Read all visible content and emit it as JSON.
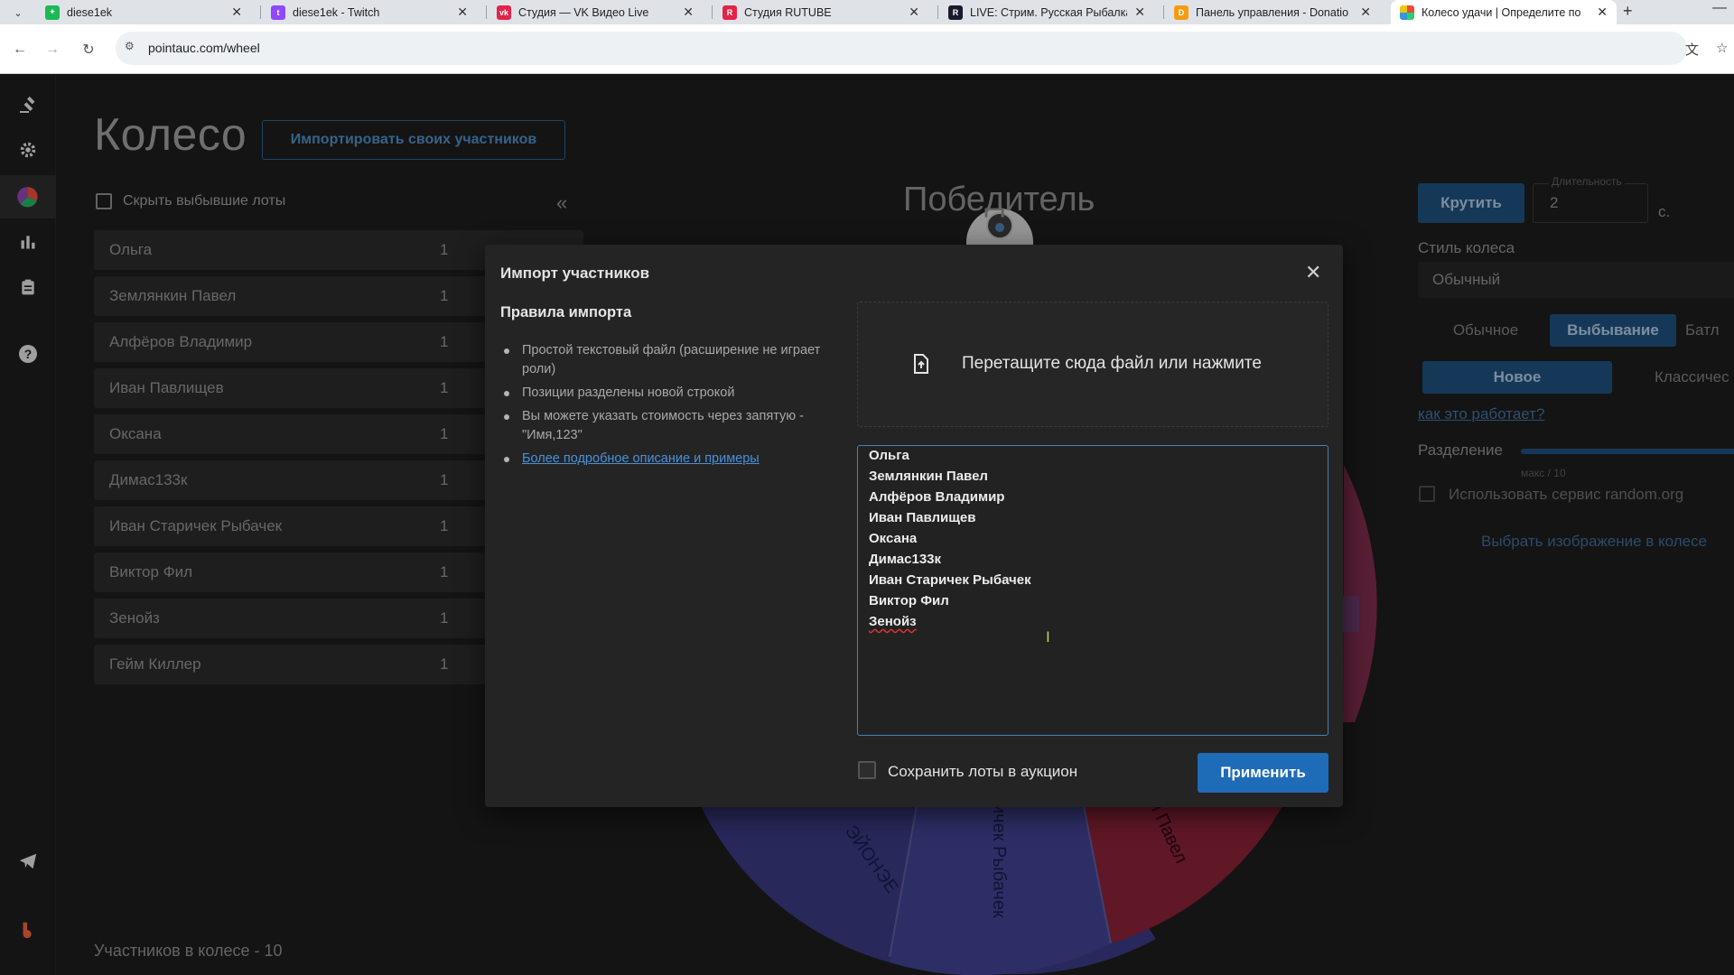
{
  "browser": {
    "tabs": [
      {
        "label": "diese1ek",
        "icon_color": "#1db954"
      },
      {
        "label": "diese1ek - Twitch",
        "icon_color": "#9146ff"
      },
      {
        "label": "Студия — VK Видео Live",
        "icon_color": "#e3244a"
      },
      {
        "label": "Студия RUTUBE",
        "icon_color": "#e3244a"
      },
      {
        "label": "LIVE: Стрим. Русская Рыбалка",
        "icon_color": "#1a1a2e"
      },
      {
        "label": "Панель управления - Donatio",
        "icon_color": "#f39c12"
      },
      {
        "label": "Колесо удачи | Определите по",
        "icon_color": "#3a7bd5"
      }
    ],
    "url": "pointauc.com/wheel"
  },
  "page": {
    "title": "Колесо",
    "import_button": "Импортировать своих участников",
    "hide_dropped_label": "Скрыть выбывшие лоты",
    "winner_title": "Победитель",
    "participants_count": "Участников в колесе - 10",
    "lots": [
      {
        "name": "Ольга",
        "value": "1"
      },
      {
        "name": "Землянкин Павел",
        "value": "1"
      },
      {
        "name": "Алфёров Владимир",
        "value": "1"
      },
      {
        "name": "Иван Павлищев",
        "value": "1"
      },
      {
        "name": "Оксана",
        "value": "1"
      },
      {
        "name": "Димас133к",
        "value": "1"
      },
      {
        "name": "Иван Старичек Рыбачек",
        "value": "1"
      },
      {
        "name": "Виктор Фил",
        "value": "1"
      },
      {
        "name": "Зенойз",
        "value": "1"
      },
      {
        "name": "Гейм Киллер",
        "value": "1"
      }
    ]
  },
  "wheel_labels": [
    "ЭЙОНЭЕ",
    "ичек Рыбачек",
    "н Павел"
  ],
  "settings": {
    "spin_button": "Крутить",
    "duration_legend": "Длительность",
    "duration_value": "2",
    "duration_unit": "с.",
    "wheel_style_label": "Стиль колеса",
    "wheel_style_value": "Обычный",
    "mode_tabs": [
      "Обычное",
      "Выбывание",
      "Батл"
    ],
    "sub_tabs": [
      "Новое",
      "Классичес"
    ],
    "how_it_works": "как это работает?",
    "split_label": "Разделение",
    "split_caption": "макс / 10",
    "random_org_label": "Использовать сервис random.org",
    "choose_image": "Выбрать изображение в колесе"
  },
  "modal": {
    "title": "Импорт участников",
    "rules_title": "Правила импорта",
    "rules": [
      "Простой текстовый файл (расширение не играет роли)",
      "Позиции разделены новой строкой",
      "Вы можете указать стоимость через запятую - \"Имя,123\""
    ],
    "rules_link": "Более подробное описание и примеры",
    "dropzone_text": "Перетащите сюда файл или нажмите",
    "textarea_lines": [
      "Ольга",
      "Землянкин Павел",
      "Алфёров Владимир",
      "Иван Павлищев",
      "Оксана",
      "Димас133к",
      "Иван Старичек Рыбачек",
      "Виктор Фил",
      "Зенойз"
    ],
    "save_label": "Сохранить лоты в аукцион",
    "apply_button": "Применить"
  },
  "colors": {
    "accent": "#1e6bb8",
    "wheel_blue": "#3c3c8c",
    "wheel_red": "#8a1e34"
  }
}
